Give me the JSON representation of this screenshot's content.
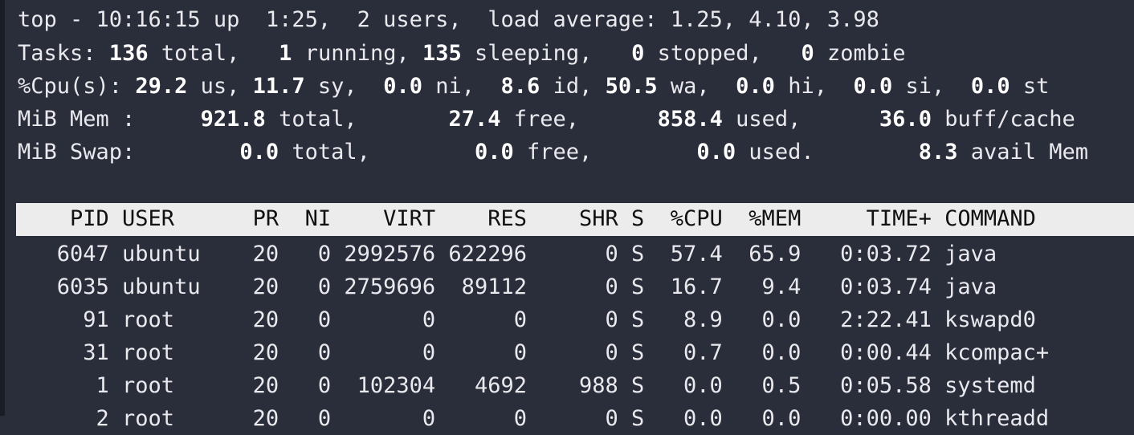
{
  "summary": {
    "uptime_line": "top - 10:16:15 up  1:25,  2 users,  load average: 1.25, 4.10, 3.98",
    "tasks": {
      "label": "Tasks:",
      "total": "136",
      "total_suffix": " total,",
      "running": "1",
      "running_suffix": " running,",
      "sleeping": "135",
      "sleeping_suffix": " sleeping,",
      "stopped": "0",
      "stopped_suffix": " stopped,",
      "zombie": "0",
      "zombie_suffix": " zombie"
    },
    "cpu": {
      "label": "%Cpu(s):",
      "us": "29.2",
      "sy": "11.7",
      "ni": "0.0",
      "id": "8.6",
      "wa": "50.5",
      "hi": "0.0",
      "si": "0.0",
      "st": "0.0"
    },
    "mem": {
      "label": "MiB Mem :",
      "total": "921.8",
      "free": "27.4",
      "used": "858.4",
      "buff_cache": "36.0"
    },
    "swap": {
      "label": "MiB Swap:",
      "total": "0.0",
      "free": "0.0",
      "used": "0.0",
      "avail_mem": "8.3"
    }
  },
  "table": {
    "header": "    PID USER      PR  NI    VIRT    RES    SHR S  %CPU  %MEM     TIME+ COMMAND",
    "rows": [
      "   6047 ubuntu    20   0 2992576 622296      0 S  57.4  65.9   0:03.72 java",
      "   6035 ubuntu    20   0 2759696  89112      0 S  16.7   9.4   0:03.74 java",
      "     91 root      20   0       0      0      0 S   8.9   0.0   2:22.41 kswapd0",
      "     31 root      20   0       0      0      0 S   0.7   0.0   0:00.44 kcompac+",
      "      1 root      20   0  102304   4692    988 S   0.0   0.5   0:05.58 systemd",
      "      2 root      20   0       0      0      0 S   0.0   0.0   0:00.00 kthreadd"
    ]
  }
}
